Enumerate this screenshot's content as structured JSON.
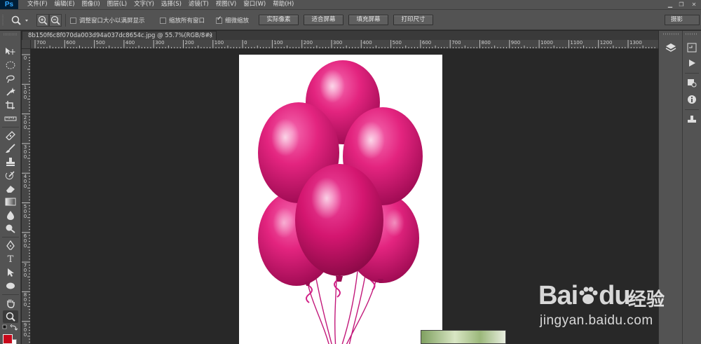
{
  "app": {
    "logo": "Ps"
  },
  "menu": [
    {
      "label": "文件(F)"
    },
    {
      "label": "编辑(E)"
    },
    {
      "label": "图像(I)"
    },
    {
      "label": "图层(L)"
    },
    {
      "label": "文字(Y)"
    },
    {
      "label": "选择(S)"
    },
    {
      "label": "滤镜(T)"
    },
    {
      "label": "视图(V)"
    },
    {
      "label": "窗口(W)"
    },
    {
      "label": "帮助(H)"
    }
  ],
  "options": {
    "resize_windows": {
      "label": "调整窗口大小以满屏显示",
      "checked": false
    },
    "zoom_all_windows": {
      "label": "缩放所有窗口",
      "checked": false
    },
    "scrubby_zoom": {
      "label": "细微缩放",
      "checked": true
    },
    "buttons": [
      {
        "label": "实际像素"
      },
      {
        "label": "适合屏幕"
      },
      {
        "label": "填充屏幕"
      },
      {
        "label": "打印尺寸"
      }
    ],
    "workspace": "摄影"
  },
  "document": {
    "tab_title": "8b150f6c8f070da003d94a037dc8654c.jpg @ 55.7%(RGB/8#)",
    "close": "×"
  },
  "ruler": {
    "top": [
      "700",
      "600",
      "500",
      "400",
      "300",
      "200",
      "100",
      "0",
      "100",
      "200",
      "300",
      "400",
      "500",
      "600",
      "700",
      "800",
      "900",
      "1000",
      "1100",
      "1200",
      "1300"
    ],
    "left": [
      "0",
      "100",
      "200",
      "300",
      "400",
      "500",
      "600",
      "700",
      "800",
      "900"
    ]
  },
  "colors": {
    "foreground": "#c8081a",
    "background": "#ffffff",
    "balloon": "#e2207e"
  },
  "watermark": {
    "brand": "Bai",
    "brand2": "du",
    "cn": "经验",
    "url": "jingyan.baidu.com"
  }
}
